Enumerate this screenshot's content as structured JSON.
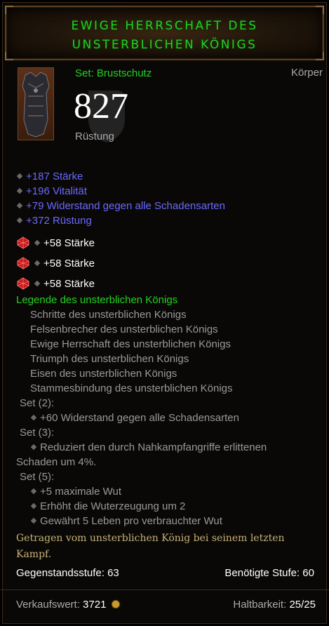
{
  "header": {
    "title_line1": "EWIGE HERRSCHAFT DES",
    "title_line2": "UNSTERBLICHEN KÖNIGS"
  },
  "item": {
    "set_type": "Set: Brustschutz",
    "slot": "Körper",
    "armor_value": "827",
    "armor_label": "Rüstung",
    "icon": "chest-armor-icon"
  },
  "primary_stats": [
    "+187 Stärke",
    "+196 Vitalität",
    "+79 Widerstand gegen alle Schadensarten",
    "+372 Rüstung"
  ],
  "sockets": [
    {
      "gem": "ruby-icon",
      "text": "+58 Stärke"
    },
    {
      "gem": "ruby-icon",
      "text": "+58 Stärke"
    },
    {
      "gem": "ruby-icon",
      "text": "+58 Stärke"
    }
  ],
  "set": {
    "name": "Legende des unsterblichen Königs",
    "pieces": [
      "Schritte des unsterblichen Königs",
      "Felsenbrecher des unsterblichen Königs",
      "Ewige Herrschaft des unsterblichen Königs",
      "Triumph des unsterblichen Königs",
      "Eisen des unsterblichen Königs",
      "Stammesbindung des unsterblichen Königs"
    ],
    "bonus2_label": "Set (2):",
    "bonus2": "+60 Widerstand gegen alle Schadensarten",
    "bonus3_label": "Set (3):",
    "bonus3_line1": "Reduziert den durch Nahkampfangriffe erlittenen",
    "bonus3_line2": "Schaden um 4%.",
    "bonus5_label": "Set (5):",
    "bonus5": [
      "+5 maximale Wut",
      "Erhöht die Wuterzeugung um 2",
      "Gewährt 5 Leben pro verbrauchter Wut"
    ]
  },
  "flavor": {
    "line1": "Getragen vom unsterblichen König bei seinem letzten",
    "line2": "Kampf."
  },
  "levels": {
    "item_level": "Gegenstandsstufe: 63",
    "required_level": "Benötigte Stufe: 60"
  },
  "footer": {
    "sell_label": "Verkaufswert:",
    "sell_value": "3721",
    "durability_label": "Haltbarkeit:",
    "durability_value": "25/25"
  },
  "colors": {
    "set_green": "#21d321",
    "magic_blue": "#6969ff",
    "flavor_gold": "#c7b377"
  }
}
